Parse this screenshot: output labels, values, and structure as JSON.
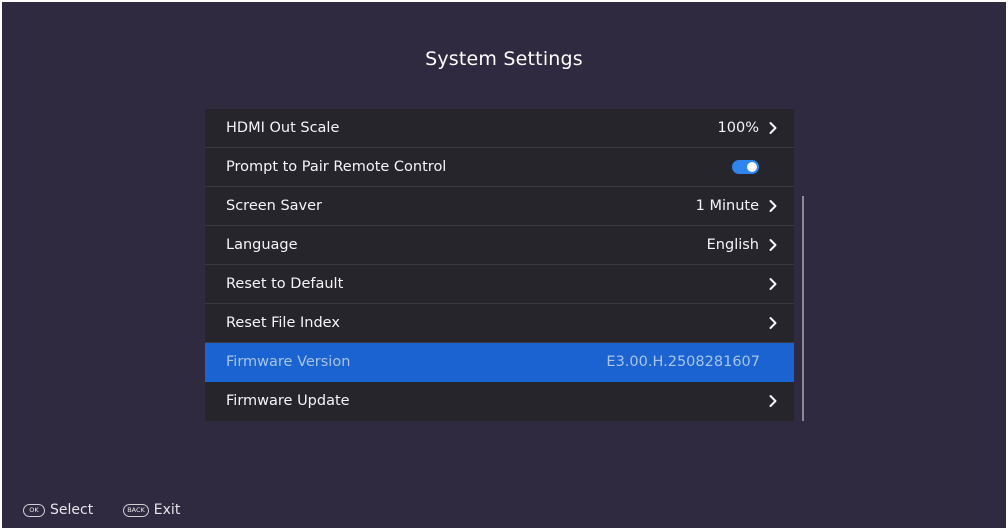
{
  "title": "System Settings",
  "settings": [
    {
      "label": "HDMI Out Scale",
      "value": "100%",
      "type": "link",
      "selected": false
    },
    {
      "label": "Prompt to Pair Remote Control",
      "value": "",
      "type": "toggle",
      "state": "on",
      "selected": false
    },
    {
      "label": "Screen Saver",
      "value": "1 Minute",
      "type": "link",
      "selected": false
    },
    {
      "label": "Language",
      "value": "English",
      "type": "link",
      "selected": false
    },
    {
      "label": "Reset to Default",
      "value": "",
      "type": "link",
      "selected": false
    },
    {
      "label": "Reset File Index",
      "value": "",
      "type": "link",
      "selected": false
    },
    {
      "label": "Firmware Version",
      "value": "E3.00.H.2508281607",
      "type": "info",
      "selected": true
    },
    {
      "label": "Firmware Update",
      "value": "",
      "type": "link",
      "selected": false
    }
  ],
  "hints": [
    {
      "key": "OK",
      "label": "Select"
    },
    {
      "key": "BACK",
      "label": "Exit"
    }
  ],
  "icons": {
    "row_arrow": "chevron-right-icon",
    "toggle": "toggle-switch-icon"
  },
  "colors": {
    "background": "#2f2a40",
    "list_background": "#26252b",
    "selected_row": "#1a63d0",
    "toggle_on": "#2c86ee"
  }
}
